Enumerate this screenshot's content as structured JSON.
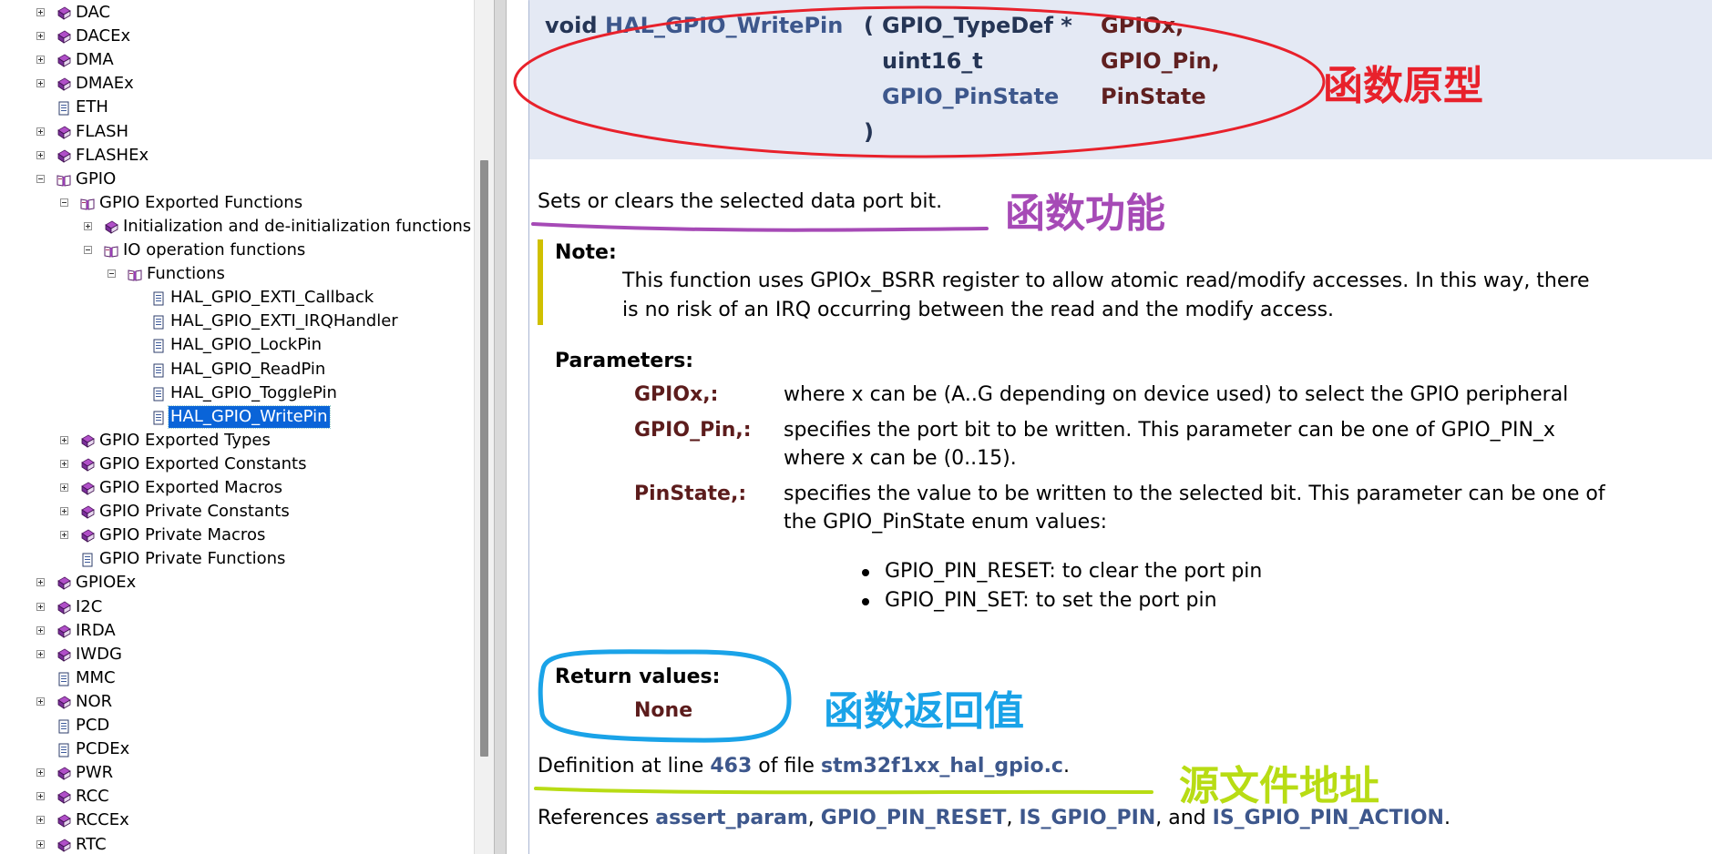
{
  "tree": {
    "items": [
      {
        "label": "DAC",
        "toggle": "plus",
        "icon": "book",
        "indent": 0
      },
      {
        "label": "DACEx",
        "toggle": "plus",
        "icon": "book",
        "indent": 0
      },
      {
        "label": "DMA",
        "toggle": "plus",
        "icon": "book",
        "indent": 0
      },
      {
        "label": "DMAEx",
        "toggle": "plus",
        "icon": "book",
        "indent": 0
      },
      {
        "label": "ETH",
        "toggle": "none",
        "icon": "page",
        "indent": 0
      },
      {
        "label": "FLASH",
        "toggle": "plus",
        "icon": "book",
        "indent": 0
      },
      {
        "label": "FLASHEx",
        "toggle": "plus",
        "icon": "book",
        "indent": 0
      },
      {
        "label": "GPIO",
        "toggle": "minus",
        "icon": "open-book",
        "indent": 0
      },
      {
        "label": "GPIO Exported Functions",
        "toggle": "minus",
        "icon": "open-book",
        "indent": 1
      },
      {
        "label": "Initialization and de-initialization functions",
        "toggle": "plus",
        "icon": "book",
        "indent": 2
      },
      {
        "label": "IO operation functions",
        "toggle": "minus",
        "icon": "open-book",
        "indent": 2
      },
      {
        "label": "Functions",
        "toggle": "minus",
        "icon": "open-book",
        "indent": 3
      },
      {
        "label": "HAL_GPIO_EXTI_Callback",
        "toggle": "none",
        "icon": "page",
        "indent": 4
      },
      {
        "label": "HAL_GPIO_EXTI_IRQHandler",
        "toggle": "none",
        "icon": "page",
        "indent": 4
      },
      {
        "label": "HAL_GPIO_LockPin",
        "toggle": "none",
        "icon": "page",
        "indent": 4
      },
      {
        "label": "HAL_GPIO_ReadPin",
        "toggle": "none",
        "icon": "page",
        "indent": 4
      },
      {
        "label": "HAL_GPIO_TogglePin",
        "toggle": "none",
        "icon": "page",
        "indent": 4
      },
      {
        "label": "HAL_GPIO_WritePin",
        "toggle": "none",
        "icon": "page",
        "indent": 4,
        "selected": true
      },
      {
        "label": "GPIO Exported Types",
        "toggle": "plus",
        "icon": "book",
        "indent": 1
      },
      {
        "label": "GPIO Exported Constants",
        "toggle": "plus",
        "icon": "book",
        "indent": 1
      },
      {
        "label": "GPIO Exported Macros",
        "toggle": "plus",
        "icon": "book",
        "indent": 1
      },
      {
        "label": "GPIO Private Constants",
        "toggle": "plus",
        "icon": "book",
        "indent": 1
      },
      {
        "label": "GPIO Private Macros",
        "toggle": "plus",
        "icon": "book",
        "indent": 1
      },
      {
        "label": "GPIO Private Functions",
        "toggle": "none",
        "icon": "page",
        "indent": 1
      },
      {
        "label": "GPIOEx",
        "toggle": "plus",
        "icon": "book",
        "indent": 0
      },
      {
        "label": "I2C",
        "toggle": "plus",
        "icon": "book",
        "indent": 0
      },
      {
        "label": "IRDA",
        "toggle": "plus",
        "icon": "book",
        "indent": 0
      },
      {
        "label": "IWDG",
        "toggle": "plus",
        "icon": "book",
        "indent": 0
      },
      {
        "label": "MMC",
        "toggle": "none",
        "icon": "page",
        "indent": 0
      },
      {
        "label": "NOR",
        "toggle": "plus",
        "icon": "book",
        "indent": 0
      },
      {
        "label": "PCD",
        "toggle": "none",
        "icon": "page",
        "indent": 0
      },
      {
        "label": "PCDEx",
        "toggle": "none",
        "icon": "page",
        "indent": 0
      },
      {
        "label": "PWR",
        "toggle": "plus",
        "icon": "book",
        "indent": 0
      },
      {
        "label": "RCC",
        "toggle": "plus",
        "icon": "book",
        "indent": 0
      },
      {
        "label": "RCCEx",
        "toggle": "plus",
        "icon": "book",
        "indent": 0
      },
      {
        "label": "RTC",
        "toggle": "plus",
        "icon": "book",
        "indent": 0
      }
    ]
  },
  "prototype": {
    "return_type": "void",
    "func_name": "HAL_GPIO_WritePin",
    "open_paren": "(",
    "close_paren": ")",
    "params": [
      {
        "type": "GPIO_TypeDef *",
        "name": "GPIOx,"
      },
      {
        "type": "uint16_t",
        "name": "GPIO_Pin,"
      },
      {
        "type": "GPIO_PinState",
        "name": "PinState"
      }
    ]
  },
  "brief": "Sets or clears the selected data port bit.",
  "note": {
    "heading": "Note:",
    "line1": "This function uses GPIOx_BSRR register to allow atomic read/modify accesses. In this way, there",
    "line2": "is no risk of an IRQ occurring between the read and the modify access."
  },
  "parameters": {
    "heading": "Parameters:",
    "items": [
      {
        "name": "GPIOx,:",
        "desc1": "where x can be (A..G depending on device used) to select the GPIO peripheral",
        "desc2": ""
      },
      {
        "name": "GPIO_Pin,:",
        "desc1": "specifies the port bit to be written. This parameter can be one of GPIO_PIN_x",
        "desc2": "where x can be (0..15)."
      },
      {
        "name": "PinState,:",
        "desc1": "specifies the value to be written to the selected bit. This parameter can be one of",
        "desc2": "the GPIO_PinState enum values:"
      }
    ],
    "enum_values": [
      "GPIO_PIN_RESET: to clear the port pin",
      "GPIO_PIN_SET: to set the port pin"
    ]
  },
  "return_values": {
    "heading": "Return values:",
    "value": "None"
  },
  "definition": {
    "prefix": "Definition at line ",
    "line": "463",
    "middle": " of file ",
    "file": "stm32f1xx_hal_gpio.c",
    "suffix": "."
  },
  "references": {
    "prefix": "References ",
    "items": [
      "assert_param",
      "GPIO_PIN_RESET",
      "IS_GPIO_PIN",
      "IS_GPIO_PIN_ACTION"
    ],
    "sep1": ", ",
    "sep2": ", ",
    "sep3": ", and ",
    "suffix": "."
  },
  "annotations": {
    "prototype": "函数原型",
    "function": "函数功能",
    "return": "函数返回值",
    "source": "源文件地址"
  },
  "colors": {
    "anno_red": "#e8212b",
    "anno_purple": "#a64ab6",
    "anno_blue": "#1aa3e8",
    "anno_green": "#b8dc14",
    "link": "#3d578c",
    "param_name": "#5c1c1c",
    "selection": "#0a64d8"
  }
}
